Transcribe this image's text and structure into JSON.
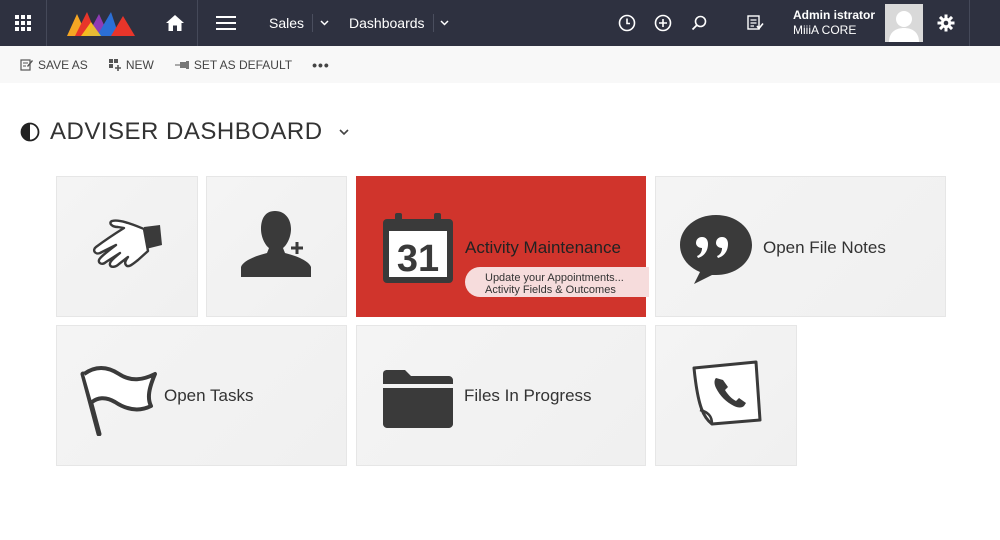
{
  "topbar": {
    "nav": {
      "primary": "Sales",
      "secondary": "Dashboards"
    },
    "user": {
      "name": "Admin istrator",
      "org": "MiiiA CORE"
    },
    "icons": {
      "apps": "waffle-icon",
      "home": "home-icon",
      "menu": "hamburger-icon",
      "recent": "clock-icon",
      "create": "plus-circle-icon",
      "search": "search-icon",
      "tasks": "task-list-icon",
      "settings": "gear-icon"
    }
  },
  "commandbar": {
    "save_as": "SAVE AS",
    "new": "NEW",
    "set_default": "SET AS DEFAULT",
    "more": "•••"
  },
  "dashboard": {
    "title": "ADVISER DASHBOARD"
  },
  "tiles": {
    "activity": {
      "label": "Activity Maintenance",
      "sub1": "Update your Appointments...",
      "sub2": "Activity Fields & Outcomes",
      "calendar_day": "31"
    },
    "file_notes": {
      "label": "Open File Notes"
    },
    "tasks": {
      "label": "Open Tasks"
    },
    "files_progress": {
      "label": "Files In Progress"
    }
  },
  "colors": {
    "topbar": "#2e3140",
    "accent_red": "#d0342c",
    "tile_bg": "#f2f2f2",
    "icon_dark": "#3a3a3a"
  }
}
